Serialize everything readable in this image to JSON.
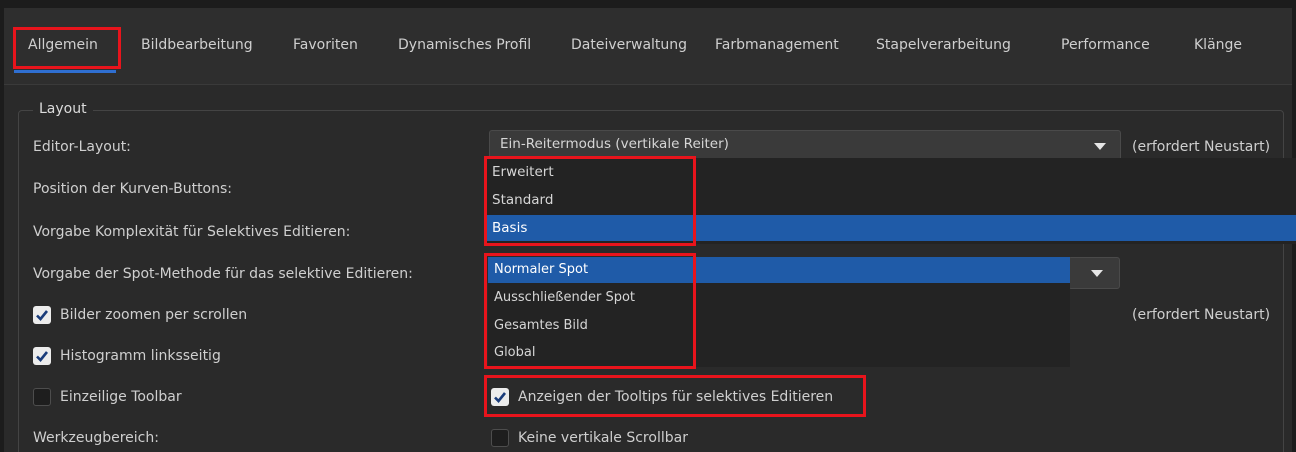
{
  "tabs": [
    {
      "label": "Allgemein",
      "active": true
    },
    {
      "label": "Bildbearbeitung"
    },
    {
      "label": "Favoriten"
    },
    {
      "label": "Dynamisches Profil"
    },
    {
      "label": "Dateiverwaltung"
    },
    {
      "label": "Farbmanagement"
    },
    {
      "label": "Stapelverarbeitung"
    },
    {
      "label": "Performance"
    },
    {
      "label": "Klänge"
    }
  ],
  "layout_group": {
    "legend": "Layout",
    "editor_layout": {
      "label": "Editor-Layout:",
      "value": "Ein-Reitermodus (vertikale Reiter)",
      "hint": "(erfordert Neustart)"
    },
    "curve_buttons": {
      "label": "Position der Kurven-Buttons:"
    },
    "complexity": {
      "label": "Vorgabe Komplexität für Selektives Editieren:",
      "options": [
        "Erweitert",
        "Standard",
        "Basis"
      ],
      "selected": "Basis"
    },
    "spot_method": {
      "label": "Vorgabe der Spot-Methode für das selektive Editieren:",
      "options": [
        "Normaler Spot",
        "Ausschließender Spot",
        "Gesamtes Bild",
        "Global"
      ],
      "selected": "Normaler Spot"
    },
    "zoom_scroll": {
      "label": "Bilder zoomen per scrollen",
      "checked": true,
      "hint": "(erfordert Neustart)"
    },
    "histogram_left": {
      "label": "Histogramm linksseitig",
      "checked": true
    },
    "single_toolbar": {
      "label": "Einzeilige Toolbar",
      "checked": false
    },
    "tooltips": {
      "label": "Anzeigen der Tooltips für selektives Editieren",
      "checked": true
    },
    "tool_area": {
      "label": "Werkzeugbereich:"
    },
    "no_vscroll": {
      "label": "Keine vertikale Scrollbar",
      "checked": false
    }
  },
  "colors": {
    "accent": "#2f6fd1",
    "selection": "#1f5ba8",
    "highlight": "#e8141c"
  }
}
